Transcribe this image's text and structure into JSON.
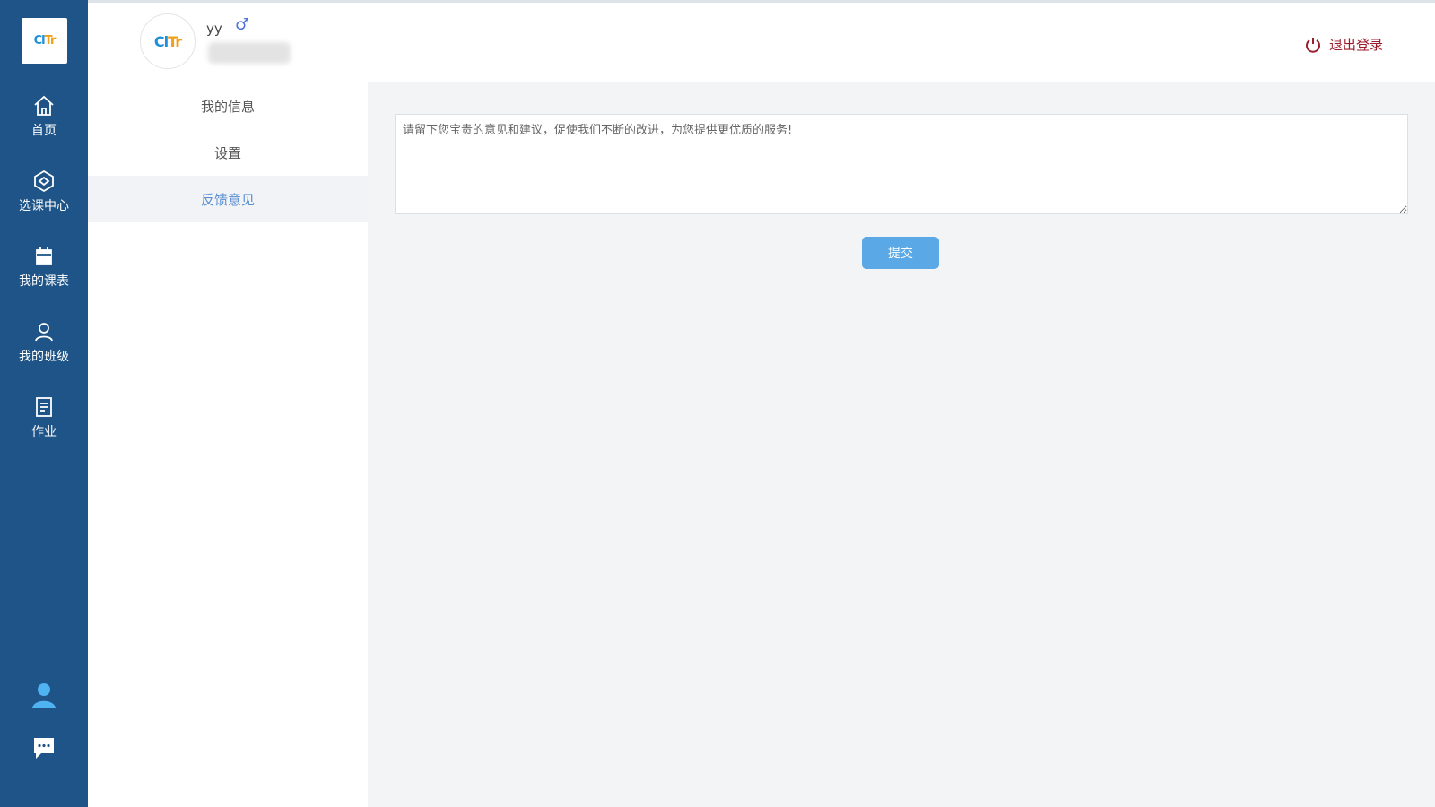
{
  "leftnav": {
    "logo": {
      "part1": "Cl",
      "part2": "Tr"
    },
    "items": [
      {
        "label": "首页",
        "icon": "home-icon"
      },
      {
        "label": "选课中心",
        "icon": "course-center-icon"
      },
      {
        "label": "我的课表",
        "icon": "calendar-icon"
      },
      {
        "label": "我的班级",
        "icon": "user-icon"
      },
      {
        "label": "作业",
        "icon": "homework-icon"
      }
    ],
    "bottom_icons": [
      "profile-icon",
      "chat-icon"
    ]
  },
  "header": {
    "avatar_text": {
      "part1": "Cl",
      "part2": "Tr"
    },
    "username": "yy",
    "gender_symbol": "♂",
    "logout_label": "退出登录"
  },
  "subnav": {
    "items": [
      {
        "label": "我的信息",
        "active": false
      },
      {
        "label": "设置",
        "active": false
      },
      {
        "label": "反馈意见",
        "active": true
      }
    ]
  },
  "main": {
    "feedback_placeholder": "请留下您宝贵的意见和建议，促使我们不断的改进，为您提供更优质的服务!",
    "submit_label": "提交"
  },
  "colors": {
    "nav_bg": "#1e5487",
    "accent": "#5aa9e6",
    "logout": "#9b1d2b",
    "active_text": "#5b8fd1"
  }
}
